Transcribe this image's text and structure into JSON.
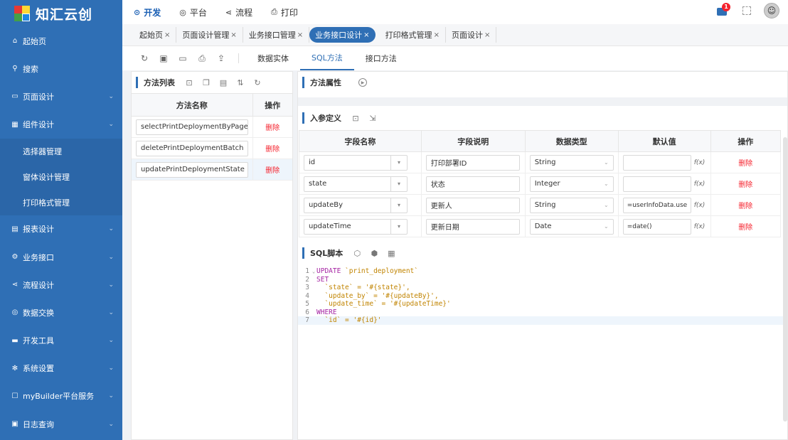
{
  "brand": {
    "name": "知汇云创"
  },
  "sidebar": {
    "items": [
      {
        "label": "起始页",
        "icon": "home-icon",
        "expand": false
      },
      {
        "label": "搜索",
        "icon": "search-icon",
        "expand": false
      },
      {
        "label": "页面设计",
        "icon": "page-icon",
        "expand": true
      },
      {
        "label": "组件设计",
        "icon": "grid-icon",
        "expand": true
      }
    ],
    "subitems": [
      "选择器管理",
      "窗体设计管理",
      "打印格式管理"
    ],
    "items2": [
      {
        "label": "报表设计",
        "icon": "report-icon"
      },
      {
        "label": "业务接口",
        "icon": "api-icon"
      },
      {
        "label": "流程设计",
        "icon": "flow-icon"
      },
      {
        "label": "数据交换",
        "icon": "database-icon"
      },
      {
        "label": "开发工具",
        "icon": "toolbox-icon"
      },
      {
        "label": "系统设置",
        "icon": "gear-icon"
      },
      {
        "label": "myBuilder平台服务",
        "icon": "service-icon"
      },
      {
        "label": "日志查询",
        "icon": "log-icon"
      }
    ]
  },
  "topnav": [
    {
      "label": "开发",
      "icon": "dev-icon",
      "active": true
    },
    {
      "label": "平台",
      "icon": "platform-icon",
      "active": false
    },
    {
      "label": "流程",
      "icon": "flow-icon",
      "active": false
    },
    {
      "label": "打印",
      "icon": "print-icon",
      "active": false
    }
  ],
  "notifications": {
    "count": "1"
  },
  "tabs": [
    {
      "label": "起始页",
      "active": false
    },
    {
      "label": "页面设计管理",
      "active": false
    },
    {
      "label": "业务接口管理",
      "active": false
    },
    {
      "label": "业务接口设计",
      "active": true
    },
    {
      "label": "打印格式管理",
      "active": false
    },
    {
      "label": "页面设计",
      "active": false
    }
  ],
  "close_glyph": "×",
  "subtabs": [
    {
      "label": "数据实体",
      "active": false
    },
    {
      "label": "SQL方法",
      "active": true
    },
    {
      "label": "接口方法",
      "active": false
    }
  ],
  "method_list": {
    "title": "方法列表",
    "headers": {
      "name": "方法名称",
      "op": "操作"
    },
    "rows": [
      {
        "name": "selectPrintDeploymentByPage",
        "op": "删除",
        "selected": false
      },
      {
        "name": "deletePrintDeploymentBatch",
        "op": "删除",
        "selected": false
      },
      {
        "name": "updatePrintDeploymentState",
        "op": "删除",
        "selected": true
      }
    ]
  },
  "method_props": {
    "title": "方法属性"
  },
  "params": {
    "title": "入参定义",
    "headers": [
      "字段名称",
      "字段说明",
      "数据类型",
      "默认值",
      "操作"
    ],
    "rows": [
      {
        "field": "id",
        "desc": "打印部署ID",
        "type": "String",
        "default": "",
        "op": "删除"
      },
      {
        "field": "state",
        "desc": "状态",
        "type": "Integer",
        "default": "",
        "op": "删除"
      },
      {
        "field": "updateBy",
        "desc": "更新人",
        "type": "String",
        "default": "=userInfoData.use",
        "op": "删除"
      },
      {
        "field": "updateTime",
        "desc": "更新日期",
        "type": "Date",
        "default": "=date()",
        "op": "删除"
      }
    ],
    "fx_label": "f(x)"
  },
  "sql": {
    "title": "SQL脚本",
    "lines": [
      {
        "n": "1",
        "kw": "UPDATE",
        "rest": " `print_deployment`",
        "fold": true
      },
      {
        "n": "2",
        "kw": "SET",
        "rest": ""
      },
      {
        "n": "3",
        "kw": "",
        "rest": "  `state` = '#{state}',"
      },
      {
        "n": "4",
        "kw": "",
        "rest": "  `update_by` = '#{updateBy}',"
      },
      {
        "n": "5",
        "kw": "",
        "rest": "  `update_time` = '#{updateTime}'"
      },
      {
        "n": "6",
        "kw": "WHERE",
        "rest": ""
      },
      {
        "n": "7",
        "kw": "",
        "rest": "  `id` = '#{id}'",
        "highlight": true
      }
    ]
  },
  "colors": {
    "primary": "#2f6fb5",
    "danger": "#f5222d",
    "keyword": "#a626a4",
    "string": "#c18401"
  }
}
